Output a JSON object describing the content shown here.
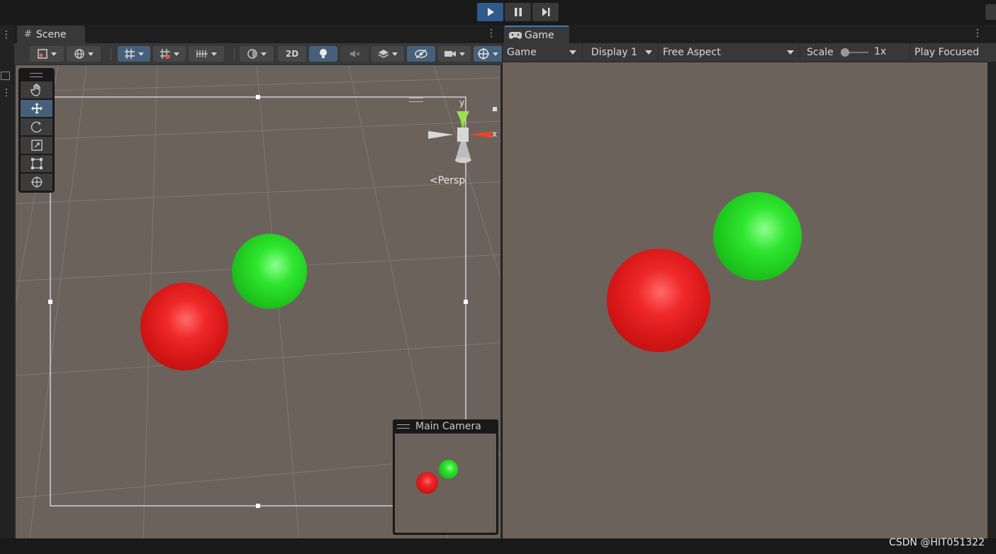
{
  "play_controls": {
    "play": {
      "icon": "play-icon",
      "active": true
    },
    "pause": {
      "icon": "pause-icon"
    },
    "step": {
      "icon": "step-icon"
    }
  },
  "scene": {
    "tab_label": "Scene",
    "toolbar": {
      "mode_2d_label": "2D"
    },
    "gizmo": {
      "y_label": "y",
      "x_label": "x",
      "projection_label": "Persp"
    },
    "tools": [
      "hand-tool",
      "move-tool",
      "rotate-tool",
      "scale-tool",
      "rect-tool",
      "transform-tool"
    ],
    "selected_tool": "move-tool",
    "camera_preview": {
      "title": "Main Camera"
    }
  },
  "game": {
    "tab_label": "Game",
    "toolbar": {
      "view_select": "Game",
      "display_select": "Display 1",
      "aspect_select": "Free Aspect",
      "scale_label": "Scale",
      "scale_value": "1x",
      "play_mode_label": "Play Focused"
    }
  },
  "colors": {
    "sphere_red": "#e82020",
    "sphere_green": "#28d828",
    "viewport_bg": "#6b625c",
    "active_blue": "#46607c",
    "play_active": "#2f5a8c"
  },
  "watermark": "CSDN @HIT051322"
}
